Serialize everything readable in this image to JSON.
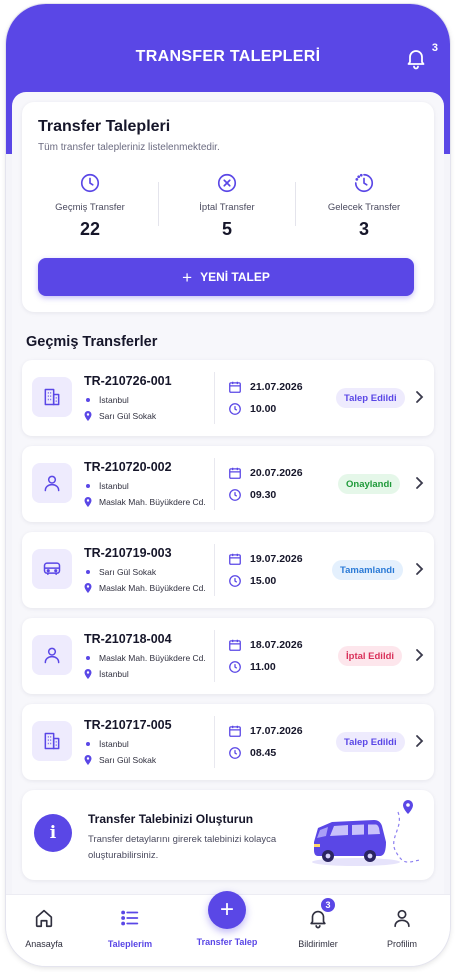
{
  "colors": {
    "primary": "#5a47e6",
    "badge_requested_bg": "#eeebfd",
    "badge_requested_fg": "#5a47e6",
    "badge_approved_bg": "#e5f7e9",
    "badge_approved_fg": "#1f9a3a",
    "badge_completed_bg": "#e4f0fd",
    "badge_completed_fg": "#2a7ad6",
    "badge_cancelled_bg": "#fde6ec",
    "badge_cancelled_fg": "#d9305a"
  },
  "header": {
    "title": "TRANSFER TALEPLERİ",
    "notification_count": "3",
    "icon": "bell-icon"
  },
  "summary": {
    "title": "Transfer Talepleri",
    "subtitle": "Tüm transfer talepleriniz listelenmektedir.",
    "stats": [
      {
        "label": "Geçmiş Transfer",
        "value": "22",
        "icon": "clock-icon"
      },
      {
        "label": "İptal Transfer",
        "value": "5",
        "icon": "cancel-circle-icon"
      },
      {
        "label": "Gelecek Transfer",
        "value": "3",
        "icon": "dashed-clock-icon"
      }
    ],
    "new_button": "YENİ TALEP"
  },
  "section_title": "Geçmiş Transferler",
  "transfers": [
    {
      "id": "TR-210726-001",
      "icon": "building-icon",
      "from": "İstanbul",
      "to": "Sarı Gül Sokak",
      "date": "21.07.2026",
      "time": "10.00",
      "status": "Talep Edildi",
      "status_key": "requested"
    },
    {
      "id": "TR-210720-002",
      "icon": "person-icon",
      "from": "İstanbul",
      "to": "Maslak Mah. Büyükdere Cd.",
      "date": "20.07.2026",
      "time": "09.30",
      "status": "Onaylandı",
      "status_key": "approved"
    },
    {
      "id": "TR-210719-003",
      "icon": "bus-icon",
      "from": "Sarı Gül Sokak",
      "to": "Maslak Mah. Büyükdere Cd.",
      "date": "19.07.2026",
      "time": "15.00",
      "status": "Tamamlandı",
      "status_key": "completed"
    },
    {
      "id": "TR-210718-004",
      "icon": "person-icon",
      "from": "Maslak Mah. Büyükdere Cd.",
      "to": "İstanbul",
      "date": "18.07.2026",
      "time": "11.00",
      "status": "İptal Edildi",
      "status_key": "cancelled"
    },
    {
      "id": "TR-210717-005",
      "icon": "building-icon",
      "from": "İstanbul",
      "to": "Sarı Gül Sokak",
      "date": "17.07.2026",
      "time": "08.45",
      "status": "Talep Edildi",
      "status_key": "requested"
    }
  ],
  "promo": {
    "icon_letter": "i",
    "title": "Transfer Talebinizi Oluşturun",
    "text": "Transfer detaylarını girerek talebinizi kolayca oluşturabilirsiniz."
  },
  "nav": {
    "items": [
      {
        "label": "Anasayfa",
        "icon": "home-icon"
      },
      {
        "label": "Taleplerim",
        "icon": "list-icon",
        "active": true
      },
      {
        "label": "Transfer Talep",
        "icon": "plus-icon"
      },
      {
        "label": "Bildirimler",
        "icon": "bell-icon",
        "badge": "3"
      },
      {
        "label": "Profilim",
        "icon": "user-icon"
      }
    ]
  }
}
